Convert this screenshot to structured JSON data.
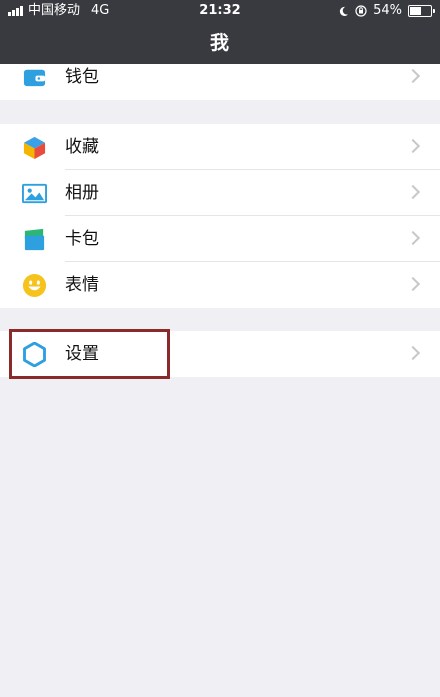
{
  "status_bar": {
    "carrier": "中国移动",
    "network": "4G",
    "time": "21:32",
    "battery_percent": "54%",
    "icons": [
      "signal-icon",
      "moon-icon",
      "orientation-lock-icon",
      "battery-icon"
    ],
    "battery_level": 0.54
  },
  "nav": {
    "title": "我"
  },
  "groups": [
    {
      "items": [
        {
          "label": "钱包",
          "icon": "wallet-icon"
        }
      ]
    },
    {
      "items": [
        {
          "label": "收藏",
          "icon": "favorites-icon"
        },
        {
          "label": "相册",
          "icon": "album-icon"
        },
        {
          "label": "卡包",
          "icon": "card-bag-icon"
        },
        {
          "label": "表情",
          "icon": "sticker-icon"
        }
      ]
    },
    {
      "items": [
        {
          "label": "设置",
          "icon": "settings-icon"
        }
      ]
    }
  ],
  "colors": {
    "topbar": "#393a3f",
    "background": "#efeff4",
    "highlight": "#8b2a2a",
    "settings_accent": "#2ea0e0"
  }
}
